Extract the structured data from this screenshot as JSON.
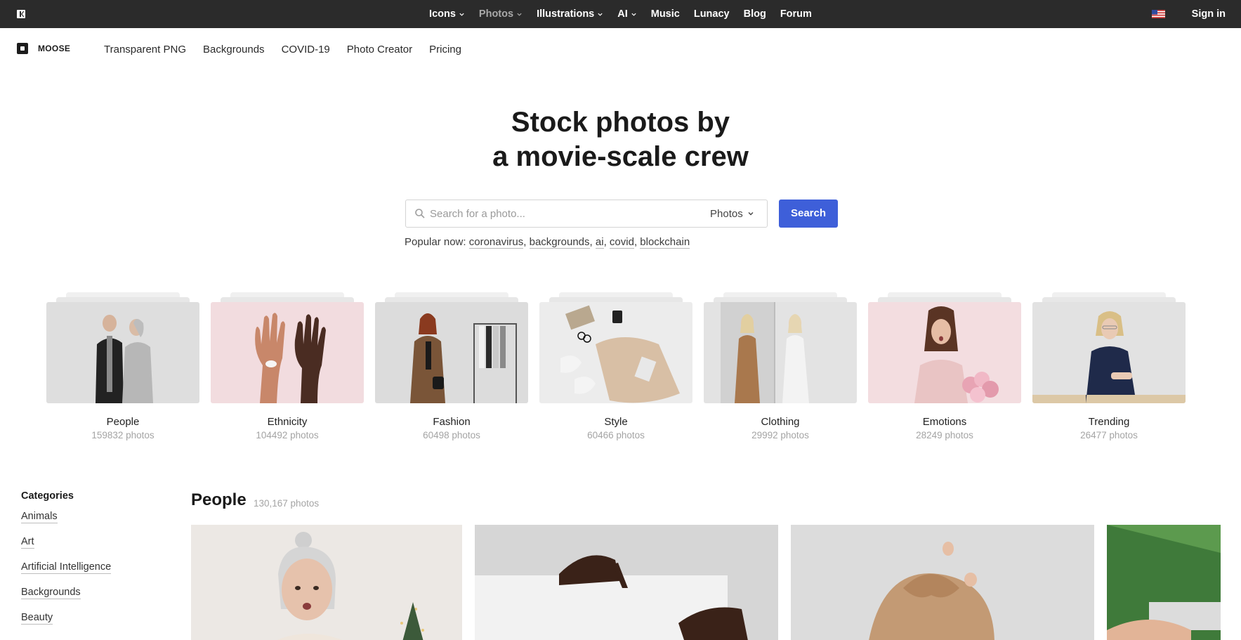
{
  "topbar": {
    "nav": [
      {
        "label": "Icons",
        "dropdown": true,
        "dim": false
      },
      {
        "label": "Photos",
        "dropdown": true,
        "dim": true
      },
      {
        "label": "Illustrations",
        "dropdown": true,
        "dim": false
      },
      {
        "label": "AI",
        "dropdown": true,
        "dim": false
      },
      {
        "label": "Music",
        "dropdown": false,
        "dim": false
      },
      {
        "label": "Lunacy",
        "dropdown": false,
        "dim": false
      },
      {
        "label": "Blog",
        "dropdown": false,
        "dim": false
      },
      {
        "label": "Forum",
        "dropdown": false,
        "dim": false
      }
    ],
    "signin_label": "Sign in",
    "flag_icon": "us-flag-icon"
  },
  "subnav": {
    "brand": "MOOSE",
    "links": [
      "Transparent PNG",
      "Backgrounds",
      "COVID-19",
      "Photo Creator",
      "Pricing"
    ]
  },
  "hero": {
    "title_line1": "Stock photos by",
    "title_line2": "a movie-scale crew"
  },
  "search": {
    "placeholder": "Search for a photo...",
    "type_label": "Photos",
    "button_label": "Search",
    "popular_label": "Popular now:",
    "popular": [
      "coronavirus",
      "backgrounds",
      "ai",
      "covid",
      "blockchain"
    ]
  },
  "categories": [
    {
      "name": "People",
      "count": "159832 photos"
    },
    {
      "name": "Ethnicity",
      "count": "104492 photos"
    },
    {
      "name": "Fashion",
      "count": "60498 photos"
    },
    {
      "name": "Style",
      "count": "60466 photos"
    },
    {
      "name": "Clothing",
      "count": "29992 photos"
    },
    {
      "name": "Emotions",
      "count": "28249 photos"
    },
    {
      "name": "Trending",
      "count": "26477 photos"
    }
  ],
  "sidebar": {
    "heading": "Categories",
    "items": [
      "Animals",
      "Art",
      "Artificial Intelligence",
      "Backgrounds",
      "Beauty"
    ]
  },
  "section": {
    "title": "People",
    "count": "130,167 photos"
  },
  "colors": {
    "topbar_bg": "#2b2b2b",
    "accent": "#3e5fd9"
  }
}
